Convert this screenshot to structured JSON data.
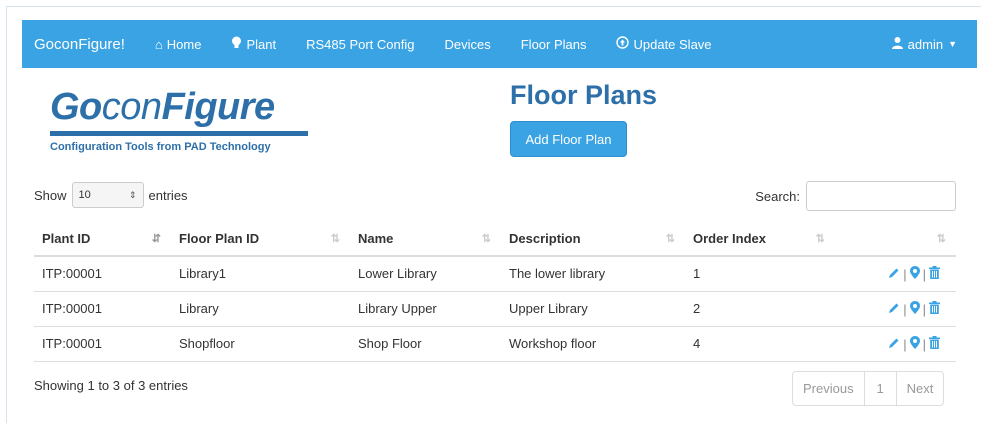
{
  "navbar": {
    "brand": "GoconFigure!",
    "items": [
      {
        "icon": "home-icon",
        "glyph": "⌂",
        "label": "Home"
      },
      {
        "icon": "lightbulb-icon",
        "glyph": "●",
        "label": "Plant"
      },
      {
        "icon": "",
        "glyph": "",
        "label": "RS485 Port Config"
      },
      {
        "icon": "",
        "glyph": "",
        "label": "Devices"
      },
      {
        "icon": "",
        "glyph": "",
        "label": "Floor Plans"
      },
      {
        "icon": "upload-icon",
        "glyph": "⊕",
        "label": "Update Slave"
      }
    ],
    "user": "admin"
  },
  "logo": {
    "word_bold1": "Go",
    "word_light": "con",
    "word_bold2": "Figure",
    "tagline": "Configuration Tools from PAD Technology"
  },
  "page": {
    "title": "Floor Plans",
    "add_button": "Add Floor Plan"
  },
  "controls": {
    "show_label": "Show",
    "entries_value": "10",
    "entries_label": "entries",
    "search_label": "Search:",
    "search_value": ""
  },
  "table": {
    "headers": [
      "Plant ID",
      "Floor Plan ID",
      "Name",
      "Description",
      "Order Index",
      ""
    ],
    "rows": [
      [
        "ITP:00001",
        "Library1",
        "Lower Library",
        "The lower library",
        "1"
      ],
      [
        "ITP:00001",
        "Library",
        "Library Upper",
        "Upper Library",
        "2"
      ],
      [
        "ITP:00001",
        "Shopfloor",
        "Shop Floor",
        "Workshop floor",
        "4"
      ]
    ]
  },
  "footer": {
    "info": "Showing 1 to 3 of 3 entries",
    "previous": "Previous",
    "page": "1",
    "next": "Next"
  },
  "colors": {
    "navbar": "#3aa3e3",
    "brand_blue": "#2d6fa8",
    "action_blue": "#3aa3e3"
  }
}
